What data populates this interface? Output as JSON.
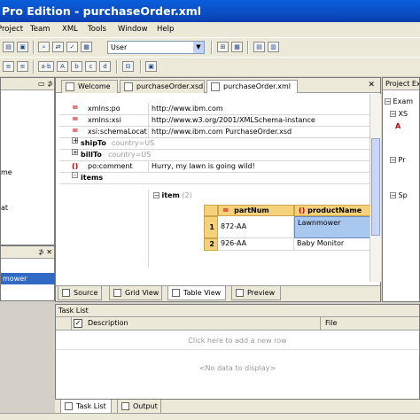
{
  "window": {
    "title": "Pro Edition - purchaseOrder.xml"
  },
  "menu": [
    "Project",
    "Team",
    "XML",
    "Tools",
    "Window",
    "Help"
  ],
  "toolbar": {
    "combo_value": "User",
    "icons": [
      "ab",
      "a+b",
      "ab",
      "A",
      "ab",
      "≡",
      "⊞",
      "■",
      "▤",
      "▤"
    ]
  },
  "left_panel": {
    "fragments": [
      "me",
      "at"
    ],
    "bottom_item": "mower"
  },
  "editor": {
    "tabs": [
      "Welcome",
      "purchaseOrder.xsd",
      "purchaseOrder.xml"
    ],
    "rows": [
      {
        "icon": "=",
        "name": "xmlns:po",
        "value": "http://www.ibm.com"
      },
      {
        "icon": "=",
        "name": "xmlns:xsi",
        "value": "http://www.w3.org/2001/XMLSchema-instance"
      },
      {
        "icon": "=",
        "name": "xsi:schemaLocat",
        "value": "http://www.ibm.com PurchaseOrder.xsd"
      },
      {
        "icon": "+",
        "name": "shipTo",
        "hint": "country=US"
      },
      {
        "icon": "+",
        "name": "billTo",
        "hint": "country=US"
      },
      {
        "icon": "()",
        "name": "po:comment",
        "value": "Hurry, my lawn is going wild!"
      },
      {
        "icon": "-",
        "name": "items"
      }
    ],
    "item_table": {
      "label": "item",
      "count": "(2)",
      "headers": [
        "partNum",
        "productName"
      ],
      "header_icons": [
        "=",
        "()"
      ],
      "rows": [
        {
          "index": "1",
          "partNum": "872-AA",
          "productName": "Lawnmower"
        },
        {
          "index": "2",
          "partNum": "926-AA",
          "productName": "Baby Monitor"
        }
      ]
    },
    "view_tabs": [
      "Source",
      "Grid View",
      "Table View",
      "Preview"
    ]
  },
  "project_explorer": {
    "title": "Project Ex",
    "items": [
      "Exam",
      "XS",
      "A",
      "Pr",
      "Sp"
    ]
  },
  "task_list": {
    "title": "Task List",
    "columns": [
      "Description",
      "File"
    ],
    "add_row_hint": "Click here to add a new row",
    "empty_text": "<No data to display>"
  },
  "bottom_tabs": [
    "Task List",
    "Output"
  ]
}
